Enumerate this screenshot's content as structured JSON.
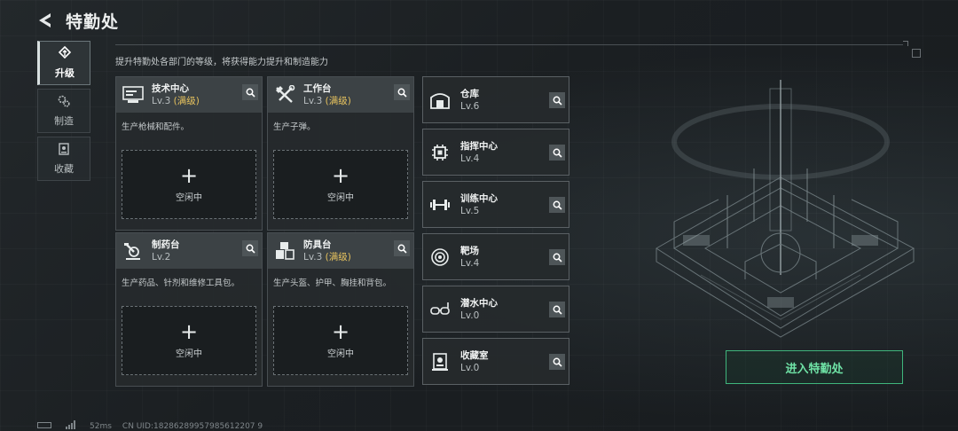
{
  "header": {
    "title": "特勤处"
  },
  "nav": [
    {
      "label": "升级",
      "icon": "upgrade-icon",
      "active": true
    },
    {
      "label": "制造",
      "icon": "gears-icon",
      "active": false
    },
    {
      "label": "收藏",
      "icon": "collection-icon",
      "active": false
    }
  ],
  "subtitle": "提升特勤处各部门的等级，将获得能力提升和制造能力",
  "cards": [
    {
      "name": "技术中心",
      "level": "Lv.3",
      "max": "(满级)",
      "desc": "生产枪械和配件。",
      "slot_plus": "+",
      "slot_text": "空闲中",
      "icon": "tech-center-icon"
    },
    {
      "name": "工作台",
      "level": "Lv.3",
      "max": "(满级)",
      "desc": "生产子弹。",
      "slot_plus": "+",
      "slot_text": "空闲中",
      "icon": "workbench-icon"
    },
    {
      "name": "制药台",
      "level": "Lv.2",
      "max": "",
      "desc": "生产药品、针剂和维修工具包。",
      "slot_plus": "+",
      "slot_text": "空闲中",
      "icon": "pharmacy-icon"
    },
    {
      "name": "防具台",
      "level": "Lv.3",
      "max": "(满级)",
      "desc": "生产头盔、护甲、胸挂和背包。",
      "slot_plus": "+",
      "slot_text": "空闲中",
      "icon": "armor-bench-icon"
    }
  ],
  "rooms": [
    {
      "name": "仓库",
      "level": "Lv.6",
      "icon": "warehouse-icon"
    },
    {
      "name": "指挥中心",
      "level": "Lv.4",
      "icon": "command-center-icon"
    },
    {
      "name": "训练中心",
      "level": "Lv.5",
      "icon": "dumbbell-icon"
    },
    {
      "name": "靶场",
      "level": "Lv.4",
      "icon": "target-icon"
    },
    {
      "name": "潜水中心",
      "level": "Lv.0",
      "icon": "diving-mask-icon"
    },
    {
      "name": "收藏室",
      "level": "Lv.0",
      "icon": "collection-room-icon"
    }
  ],
  "enter_button": "进入特勤处",
  "footer": {
    "ping": "52ms",
    "uid": "CN UID:18286289957985612207 9"
  },
  "colors": {
    "accent_green": "#3fb57c",
    "max_gold": "#e6c25e"
  }
}
